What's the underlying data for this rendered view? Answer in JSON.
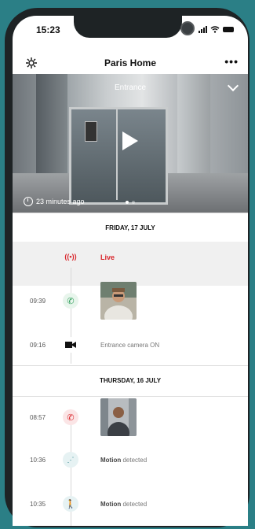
{
  "status_bar": {
    "time": "15:23"
  },
  "header": {
    "title": "Paris Home",
    "more": "•••"
  },
  "camera": {
    "label": "Entrance",
    "ago": "23 minutes ago"
  },
  "days": [
    {
      "label": "FRIDAY, 17 JULY"
    },
    {
      "label": "THURSDAY, 16 JULY"
    }
  ],
  "events": [
    {
      "time": "",
      "label": "Live",
      "icon": "live-icon"
    },
    {
      "time": "09:39",
      "label": "",
      "icon": "phone-icon"
    },
    {
      "time": "09:16",
      "label": "Entrance camera ON",
      "icon": "video-camera-icon"
    },
    {
      "time": "08:57",
      "label": "",
      "icon": "missed-call-icon"
    },
    {
      "time": "10:36",
      "bold": "Motion",
      "label": "detected",
      "icon": "motion-icon"
    },
    {
      "time": "10:35",
      "bold": "Motion",
      "label": "detected",
      "icon": "walking-person-icon"
    }
  ],
  "colors": {
    "accent_red": "#d9262c",
    "teal_bg": "#2b7f86",
    "green": "#2f9e5a"
  }
}
